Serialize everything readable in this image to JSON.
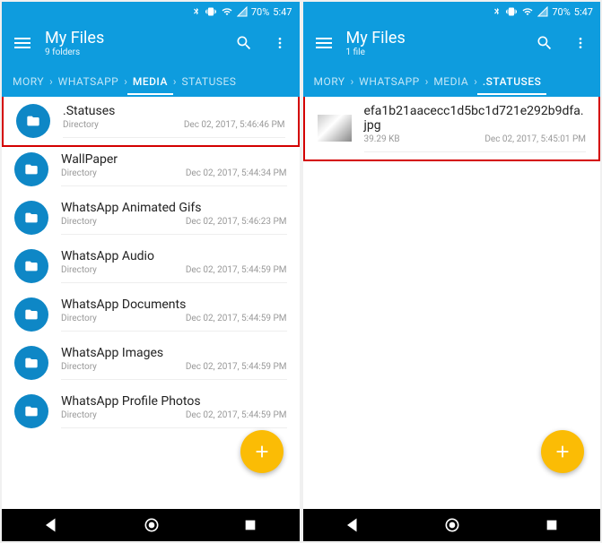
{
  "status": {
    "battery": "70%",
    "time": "5:47"
  },
  "left": {
    "title": "My Files",
    "subtitle": "9 folders",
    "breadcrumbs": [
      {
        "label": "MORY",
        "active": false
      },
      {
        "label": "WHATSAPP",
        "active": false
      },
      {
        "label": "MEDIA",
        "active": true
      },
      {
        "label": "STATUSES",
        "active": false
      }
    ],
    "items": [
      {
        "name": ".Statuses",
        "type": "Directory",
        "date": "Dec 02, 2017, 5:46:46 PM",
        "highlight": true
      },
      {
        "name": "WallPaper",
        "type": "Directory",
        "date": "Dec 02, 2017, 5:44:34 PM",
        "highlight": false
      },
      {
        "name": "WhatsApp Animated Gifs",
        "type": "Directory",
        "date": "Dec 02, 2017, 5:46:23 PM",
        "highlight": false
      },
      {
        "name": "WhatsApp Audio",
        "type": "Directory",
        "date": "Dec 02, 2017, 5:44:59 PM",
        "highlight": false
      },
      {
        "name": "WhatsApp Documents",
        "type": "Directory",
        "date": "Dec 02, 2017, 5:44:59 PM",
        "highlight": false
      },
      {
        "name": "WhatsApp Images",
        "type": "Directory",
        "date": "Dec 02, 2017, 5:44:59 PM",
        "highlight": false
      },
      {
        "name": "WhatsApp Profile Photos",
        "type": "Directory",
        "date": "Dec 02, 2017, 5:44:59 PM",
        "highlight": false
      }
    ]
  },
  "right": {
    "title": "My Files",
    "subtitle": "1 file",
    "breadcrumbs": [
      {
        "label": "MORY",
        "active": false
      },
      {
        "label": "WHATSAPP",
        "active": false
      },
      {
        "label": "MEDIA",
        "active": false
      },
      {
        "label": ".STATUSES",
        "active": true
      }
    ],
    "items": [
      {
        "name": "efa1b21aacecc1d5bc1d721e292b9dfa.jpg",
        "size": "39.29 KB",
        "date": "Dec 02, 2017, 5:45:01 PM",
        "highlight": true,
        "isFile": true
      }
    ]
  }
}
